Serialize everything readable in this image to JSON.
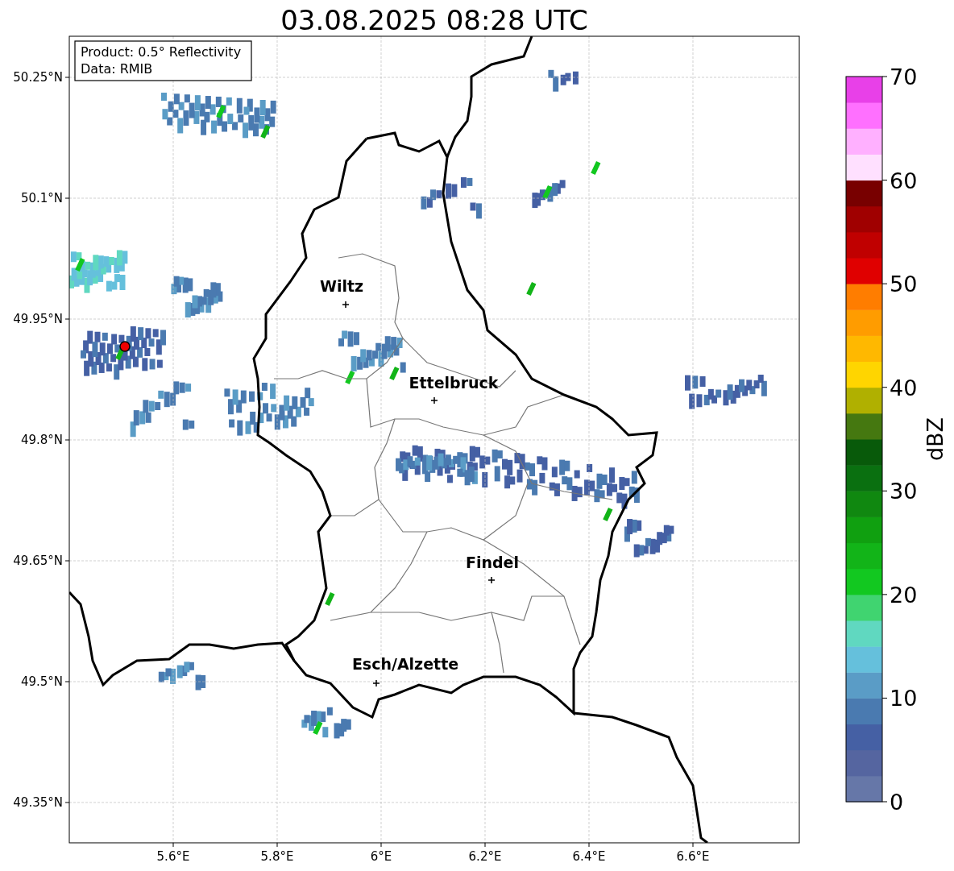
{
  "title": "03.08.2025 08:28 UTC",
  "info_box": [
    "Product: 0.5° Reflectivity",
    "Data: RMIB"
  ],
  "map": {
    "x_ticks": [
      "5.6°E",
      "5.8°E",
      "6°E",
      "6.2°E",
      "6.4°E",
      "6.6°E"
    ],
    "y_ticks": [
      "50.25°N",
      "50.1°N",
      "49.95°N",
      "49.8°N",
      "49.65°N",
      "49.5°N",
      "49.35°N"
    ],
    "cities": [
      {
        "name": "Wiltz"
      },
      {
        "name": "Ettelbruck"
      },
      {
        "name": "Findel"
      },
      {
        "name": "Esch/Alzette"
      }
    ]
  },
  "colorbar": {
    "label": "dBZ",
    "ticks": [
      "70",
      "60",
      "50",
      "40",
      "30",
      "20",
      "10",
      "0"
    ],
    "bins": [
      {
        "color": "#6677a8"
      },
      {
        "color": "#5565a0"
      },
      {
        "color": "#4560a4"
      },
      {
        "color": "#4a7ab0"
      },
      {
        "color": "#5a9cc6"
      },
      {
        "color": "#65c0dc"
      },
      {
        "color": "#60d8c0"
      },
      {
        "color": "#40d470"
      },
      {
        "color": "#12c820"
      },
      {
        "color": "#12b418"
      },
      {
        "color": "#10a010"
      },
      {
        "color": "#108810"
      },
      {
        "color": "#0a7010"
      },
      {
        "color": "#085a0a"
      },
      {
        "color": "#457810"
      },
      {
        "color": "#b0b000"
      },
      {
        "color": "#ffd500"
      },
      {
        "color": "#ffb800"
      },
      {
        "color": "#ff9c00"
      },
      {
        "color": "#ff7d00"
      },
      {
        "color": "#e00000"
      },
      {
        "color": "#c00000"
      },
      {
        "color": "#a00000"
      },
      {
        "color": "#780000"
      },
      {
        "color": "#ffe0ff"
      },
      {
        "color": "#ffb0ff"
      },
      {
        "color": "#ff70ff"
      },
      {
        "color": "#e840e8"
      }
    ]
  }
}
